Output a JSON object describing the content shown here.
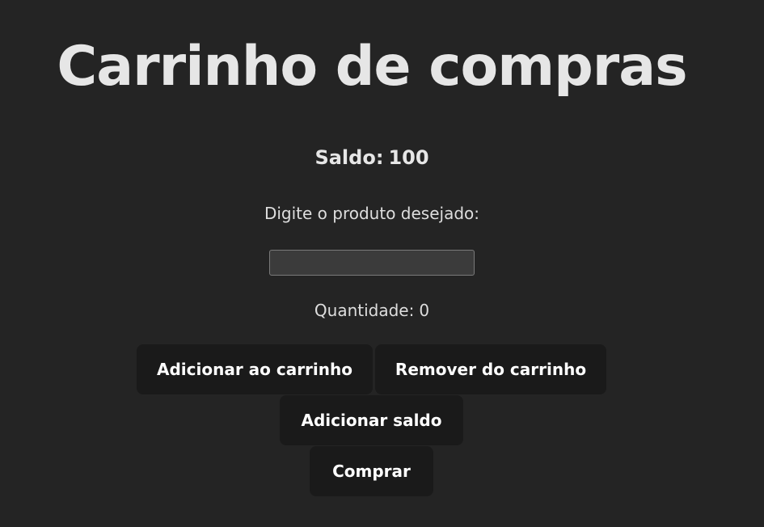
{
  "page": {
    "title": "Carrinho de compras"
  },
  "balance": {
    "label": "Saldo:",
    "value": "100"
  },
  "product": {
    "prompt": "Digite o produto desejado:",
    "input_value": "",
    "input_placeholder": ""
  },
  "quantity": {
    "label": "Quantidade:",
    "value": "0"
  },
  "actions": {
    "add_to_cart": "Adicionar ao carrinho",
    "remove_from_cart": "Remover do carrinho",
    "add_balance": "Adicionar saldo",
    "buy": "Comprar"
  },
  "colors": {
    "background": "#242424",
    "button_background": "#1a1a1a",
    "input_background": "#3b3b3b",
    "text": "#e6e6e6"
  }
}
